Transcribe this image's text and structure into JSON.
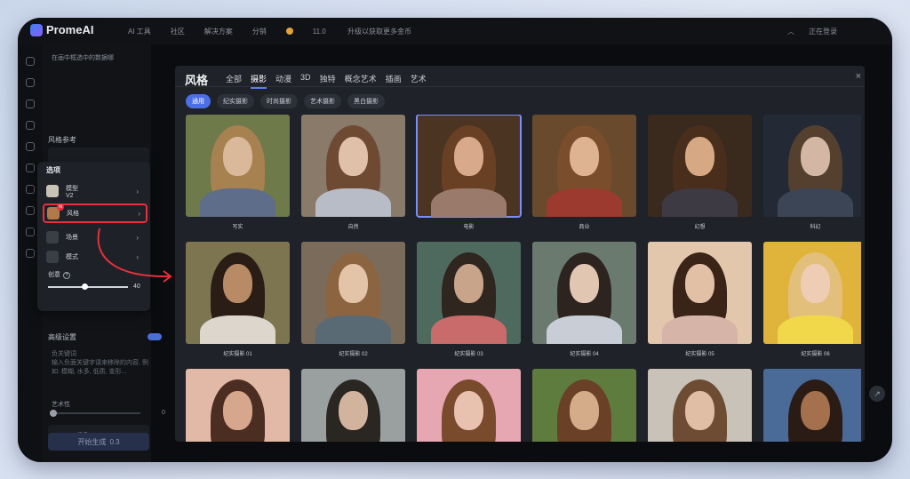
{
  "app": {
    "name": "PromeAI"
  },
  "nav": {
    "items": [
      "AI 工具",
      "社区",
      "解决方案",
      "分销"
    ],
    "promo_count": "11.0",
    "promo_text": "升级以获取更多金币"
  },
  "top_right": {
    "user_label": "正在登录"
  },
  "left_panel": {
    "prompt_hint": "在画中框选中的数据哪",
    "style_ref_label": "风格参考",
    "advanced_label": "高级设置",
    "negative_label": "负关键词",
    "negative_hint": "输入负面关键字请来移除的内容, 例如: 模糊, 水多, 低质, 变形...",
    "artistry_label": "艺术性",
    "artistry_value": "0",
    "view_label": "视角",
    "generate_label": "开始生成",
    "generate_cost": "0.3"
  },
  "options": {
    "title": "选项",
    "items": [
      {
        "label": "模型",
        "sub": "V2"
      },
      {
        "label": "风格",
        "badge": "N"
      },
      {
        "label": "场景"
      },
      {
        "label": "模式"
      }
    ],
    "creativity_label": "创意",
    "creativity_value": "40",
    "creativity_level": 0.45
  },
  "modal": {
    "title": "风格",
    "tabs": [
      "全部",
      "摄影",
      "动漫",
      "3D",
      "独特",
      "概念艺术",
      "插画",
      "艺术"
    ],
    "active_tab": 1,
    "chips": [
      "通用",
      "纪实摄影",
      "时尚摄影",
      "艺术摄影",
      "黑白摄影"
    ],
    "active_chip": 0,
    "close_icon": "close-icon",
    "cards": [
      {
        "label": "写实",
        "bg": "#6f7a4a",
        "skin": "#d9b99a",
        "hair": "#a7814f",
        "body": "#5d6d8a"
      },
      {
        "label": "自然",
        "bg": "#8a7a6a",
        "skin": "#e0c0a8",
        "hair": "#6e4a33",
        "body": "#b7bcc6"
      },
      {
        "label": "电影",
        "bg": "#4b3522",
        "skin": "#d8a98a",
        "hair": "#6a4024",
        "body": "#9a7a6a",
        "selected": true
      },
      {
        "label": "商业",
        "bg": "#6a4a2c",
        "skin": "#deb392",
        "hair": "#7a4e2c",
        "body": "#9c3a30"
      },
      {
        "label": "幻想",
        "bg": "#3a2a1e",
        "skin": "#d6a884",
        "hair": "#4a2e1c",
        "body": "#3e3a44"
      },
      {
        "label": "科幻",
        "bg": "#232a36",
        "skin": "#d3b7a4",
        "hair": "#55402f",
        "body": "#3c4556"
      },
      {
        "label": "纪实摄影 01",
        "bg": "#7d7550",
        "skin": "#b98a66",
        "hair": "#2a1d16",
        "body": "#dcd6cc"
      },
      {
        "label": "纪实摄影 02",
        "bg": "#7a6b5a",
        "skin": "#e3c4a8",
        "hair": "#8d6440",
        "body": "#5a6a74"
      },
      {
        "label": "纪实摄影 03",
        "bg": "#4e6a5e",
        "skin": "#c7a48a",
        "hair": "#2e261f",
        "body": "#c96b6b"
      },
      {
        "label": "纪实摄影 04",
        "bg": "#6b7a6e",
        "skin": "#e1c6b2",
        "hair": "#2d2420",
        "body": "#c9ced6"
      },
      {
        "label": "纪实摄影 05",
        "bg": "#e3c7ac",
        "skin": "#e2c0a6",
        "hair": "#3a2418",
        "body": "#d7b4a8"
      },
      {
        "label": "纪实摄影 06",
        "bg": "#e0b43a",
        "skin": "#efcdb5",
        "hair": "#e2c07c",
        "body": "#f1d84a"
      },
      {
        "label": "",
        "bg": "#e2b9a6",
        "skin": "#d7a78d",
        "hair": "#4b2d22",
        "body": "#d8b0a0"
      },
      {
        "label": "",
        "bg": "#9aa0a0",
        "skin": "#d1b39e",
        "hair": "#2a2622",
        "body": "#7a7068"
      },
      {
        "label": "",
        "bg": "#e6a6b2",
        "skin": "#e8c2ae",
        "hair": "#7a4a2c",
        "body": "#f0d2c8"
      },
      {
        "label": "",
        "bg": "#5e7c3e",
        "skin": "#d5ac8a",
        "hair": "#6a4026",
        "body": "#a2a24a"
      },
      {
        "label": "",
        "bg": "#c8c2b8",
        "skin": "#e0bea6",
        "hair": "#6e4c34",
        "body": "#d2c4b8"
      },
      {
        "label": "",
        "bg": "#4a6a98",
        "skin": "#a4704e",
        "hair": "#2a1c14",
        "body": "#2c3448"
      }
    ]
  },
  "colors": {
    "accent": "#4d6fe6",
    "highlight": "#e6313d",
    "modal_bg": "#1f2228"
  }
}
